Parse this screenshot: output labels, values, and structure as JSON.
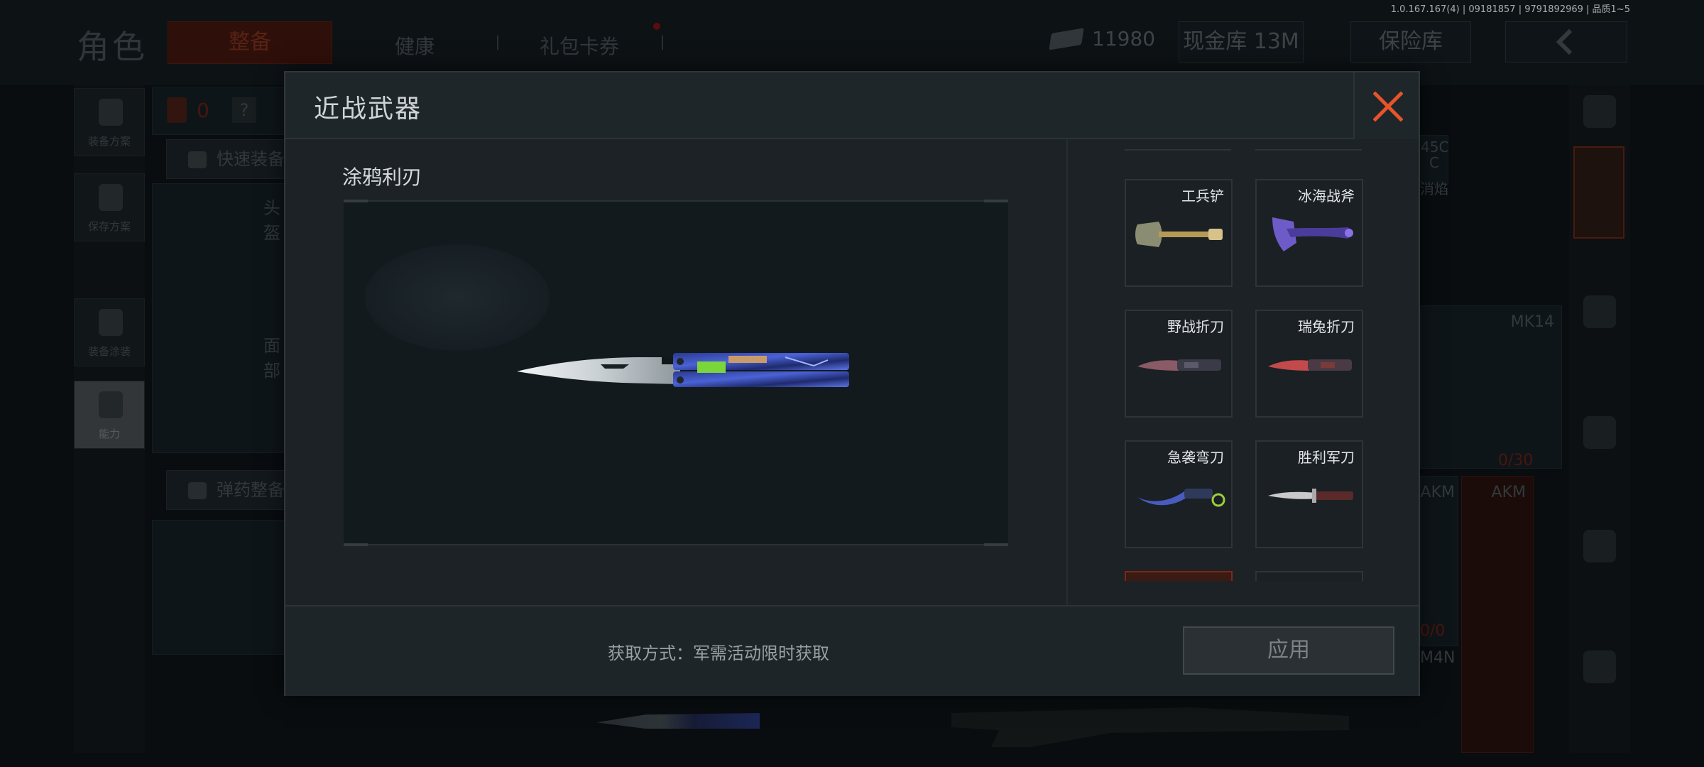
{
  "version_info": "1.0.167.167(4) | 09181857 | 9791892969 | 品质1~5",
  "background": {
    "page_title": "角色",
    "tabs": [
      {
        "label": "整备",
        "active": true
      },
      {
        "label": "健康",
        "active": false
      },
      {
        "label": "礼包卡券",
        "active": false
      }
    ],
    "currency_value": "11980",
    "cash_storage": "现金库 13M",
    "safe_storage": "保险库",
    "left_rail": [
      {
        "label": "装备方案",
        "icon": "vest-icon"
      },
      {
        "label": "保存方案",
        "icon": "download-icon"
      },
      {
        "label": "装备涂装",
        "icon": "helmet-paint-icon"
      },
      {
        "label": "能力",
        "icon": "lightning-hex-icon",
        "active": true
      }
    ],
    "backpack_count": "0",
    "help_label": "?",
    "quick_equip": "快速装备",
    "head_label": "头盔",
    "face_label": "面部",
    "ammo_equip": "弹药整备",
    "weapon_labels": [
      "MK14",
      "AKM",
      "AKM",
      "M4N"
    ],
    "ammo_counts": [
      "0/30",
      "0/0"
    ],
    "partial_stats": [
      "45C",
      "C",
      "消焰"
    ]
  },
  "modal": {
    "title": "近战武器",
    "selected_weapon_name": "涂鸦利刃",
    "close_icon": "close-x-icon",
    "accent_color": "#e8542a",
    "items": [
      {
        "name": "工兵铲",
        "icon": "shovel-icon"
      },
      {
        "name": "冰海战斧",
        "icon": "axe-icon"
      },
      {
        "name": "野战折刀",
        "icon": "field-knife-icon"
      },
      {
        "name": "瑞兔折刀",
        "icon": "rabbit-knife-icon"
      },
      {
        "name": "急袭弯刀",
        "icon": "karambit-icon"
      },
      {
        "name": "胜利军刀",
        "icon": "victory-knife-icon"
      }
    ],
    "obtain_text": "获取方式：军需活动限时获取",
    "apply_label": "应用"
  }
}
